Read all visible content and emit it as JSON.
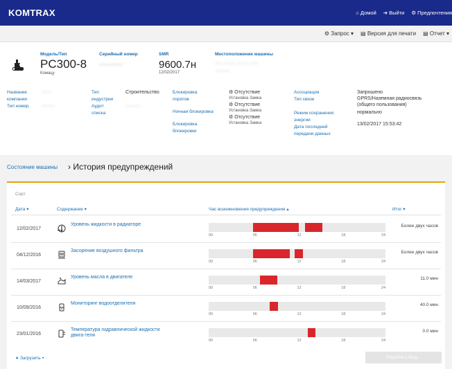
{
  "app": {
    "logo": "KOMTRAX",
    "nav": {
      "home": "⌂ Домой",
      "logout": "➔ Выйти",
      "prefs": "⚙ Предпочтения"
    }
  },
  "toolbar": {
    "query": "⚙ Запрос ▾",
    "print": "▤ Версия для печати",
    "report": "▤ Отчет ▾"
  },
  "machine": {
    "model_label": "Модель/Тип",
    "model_value": "PC300-8",
    "model_sub": "Комацу",
    "serial_label": "Серийный номер",
    "serial_value": "········",
    "smr_label": "SMR",
    "smr_value": "9600.7н",
    "smr_date": "12/02/2017",
    "location_label": "Местоположение машины",
    "location_value": "···· ······ ······ ·····",
    "location_value2": "········",
    "col1_l1": "Название",
    "col1_l2": "компании",
    "col1_l3": "Тип номер",
    "col1_v1": "······",
    "col1_v2": "········",
    "col2_l1": "Тип",
    "col2_l2": "индустрии",
    "col2_l3": "Аудит",
    "col2_l4": "списка",
    "col2_v1": "Строительство",
    "col2_v2": "·········",
    "col3_l1": "Блокировка",
    "col3_l2": "порогов",
    "col3_l3": "Ночная блокировка",
    "col3_l4": "Блокировка",
    "col3_l5": "блокировки",
    "col4_v1": "⚙ Отсутствие",
    "col4_v2": "Установка Замка",
    "col4_v3": "⚙ Отсутствие",
    "col4_v4": "Установка Замка",
    "col4_v5": "⚙ Отсутствие",
    "col4_v6": "Установка Замка",
    "col5_l1": "Ассоциация",
    "col5_l2": "Тип связи",
    "col5_l3": "Режим сохранения",
    "col5_l4": "энергии",
    "col5_l5": "Дата последней",
    "col5_l6": "передачи данных",
    "col6_v1": "Запрошено",
    "col6_v2": "GPRS/Наземная радиосвязь",
    "col6_v3": "(общего пользования)",
    "col6_v4": "нормально",
    "col6_v5": "13/02/2017 15:53:42"
  },
  "breadcrumb": {
    "link": "Состояние машины",
    "separator": " › ",
    "title": "История предупреждений"
  },
  "list": {
    "sort_label": "Сорт",
    "headers": {
      "date": "Дата ▾",
      "content": "Содержание ▾",
      "hours": "Час возникновения предупреждения ▴",
      "total": "Итог ▾"
    },
    "tick_labels": [
      "00",
      "06",
      "12",
      "18",
      "24"
    ],
    "rows": [
      {
        "date": "12/02/2017",
        "icon": "coolant-temp-icon",
        "desc": "Уровень жидкости в радиаторе",
        "total": "Более двух часов",
        "segments": [
          [
            6.0,
            12.2
          ],
          [
            13.1,
            15.4
          ]
        ]
      },
      {
        "date": "04/12/2016",
        "icon": "air-filter-icon",
        "desc": "Засорение воздушного фильтра",
        "total": "Более двух часов",
        "segments": [
          [
            6.0,
            11.0
          ],
          [
            11.7,
            12.8
          ]
        ]
      },
      {
        "date": "14/03/2017",
        "icon": "oil-level-icon",
        "desc": "Уровень масла в двигателе",
        "total": "11.0 мин",
        "segments": [
          [
            7.0,
            9.3
          ]
        ]
      },
      {
        "date": "10/09/2016",
        "icon": "water-separator-icon",
        "desc": "Мониторинг водоотделителя",
        "total": "40.0 мин",
        "segments": [
          [
            8.3,
            9.4
          ]
        ]
      },
      {
        "date": "23/01/2016",
        "icon": "oil-temp-icon",
        "desc": "Температура гидравлической жидкости двига-теля",
        "total": "0.0 мин",
        "segments": [
          [
            13.5,
            14.5
          ]
        ]
      }
    ],
    "load_more": "⯅ Загрузить ▾",
    "disabled_button": "Перейти к Мод..."
  },
  "colors": {
    "topbar": "#1a2a8a",
    "accent": "#e8a000",
    "bar_fill": "#d9262c",
    "link": "#1a6fb3"
  }
}
